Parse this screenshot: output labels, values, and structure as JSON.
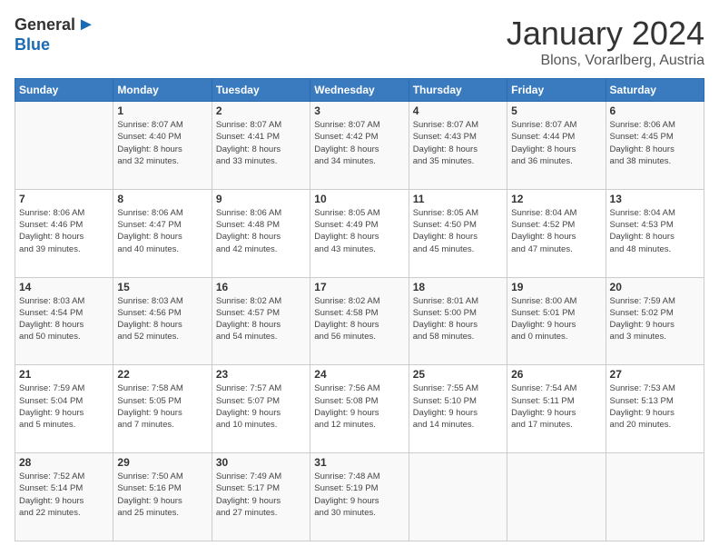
{
  "logo": {
    "general": "General",
    "blue": "Blue"
  },
  "header": {
    "month": "January 2024",
    "location": "Blons, Vorarlberg, Austria"
  },
  "days_of_week": [
    "Sunday",
    "Monday",
    "Tuesday",
    "Wednesday",
    "Thursday",
    "Friday",
    "Saturday"
  ],
  "weeks": [
    [
      {
        "day": "",
        "info": ""
      },
      {
        "day": "1",
        "info": "Sunrise: 8:07 AM\nSunset: 4:40 PM\nDaylight: 8 hours\nand 32 minutes."
      },
      {
        "day": "2",
        "info": "Sunrise: 8:07 AM\nSunset: 4:41 PM\nDaylight: 8 hours\nand 33 minutes."
      },
      {
        "day": "3",
        "info": "Sunrise: 8:07 AM\nSunset: 4:42 PM\nDaylight: 8 hours\nand 34 minutes."
      },
      {
        "day": "4",
        "info": "Sunrise: 8:07 AM\nSunset: 4:43 PM\nDaylight: 8 hours\nand 35 minutes."
      },
      {
        "day": "5",
        "info": "Sunrise: 8:07 AM\nSunset: 4:44 PM\nDaylight: 8 hours\nand 36 minutes."
      },
      {
        "day": "6",
        "info": "Sunrise: 8:06 AM\nSunset: 4:45 PM\nDaylight: 8 hours\nand 38 minutes."
      }
    ],
    [
      {
        "day": "7",
        "info": "Sunrise: 8:06 AM\nSunset: 4:46 PM\nDaylight: 8 hours\nand 39 minutes."
      },
      {
        "day": "8",
        "info": "Sunrise: 8:06 AM\nSunset: 4:47 PM\nDaylight: 8 hours\nand 40 minutes."
      },
      {
        "day": "9",
        "info": "Sunrise: 8:06 AM\nSunset: 4:48 PM\nDaylight: 8 hours\nand 42 minutes."
      },
      {
        "day": "10",
        "info": "Sunrise: 8:05 AM\nSunset: 4:49 PM\nDaylight: 8 hours\nand 43 minutes."
      },
      {
        "day": "11",
        "info": "Sunrise: 8:05 AM\nSunset: 4:50 PM\nDaylight: 8 hours\nand 45 minutes."
      },
      {
        "day": "12",
        "info": "Sunrise: 8:04 AM\nSunset: 4:52 PM\nDaylight: 8 hours\nand 47 minutes."
      },
      {
        "day": "13",
        "info": "Sunrise: 8:04 AM\nSunset: 4:53 PM\nDaylight: 8 hours\nand 48 minutes."
      }
    ],
    [
      {
        "day": "14",
        "info": "Sunrise: 8:03 AM\nSunset: 4:54 PM\nDaylight: 8 hours\nand 50 minutes."
      },
      {
        "day": "15",
        "info": "Sunrise: 8:03 AM\nSunset: 4:56 PM\nDaylight: 8 hours\nand 52 minutes."
      },
      {
        "day": "16",
        "info": "Sunrise: 8:02 AM\nSunset: 4:57 PM\nDaylight: 8 hours\nand 54 minutes."
      },
      {
        "day": "17",
        "info": "Sunrise: 8:02 AM\nSunset: 4:58 PM\nDaylight: 8 hours\nand 56 minutes."
      },
      {
        "day": "18",
        "info": "Sunrise: 8:01 AM\nSunset: 5:00 PM\nDaylight: 8 hours\nand 58 minutes."
      },
      {
        "day": "19",
        "info": "Sunrise: 8:00 AM\nSunset: 5:01 PM\nDaylight: 9 hours\nand 0 minutes."
      },
      {
        "day": "20",
        "info": "Sunrise: 7:59 AM\nSunset: 5:02 PM\nDaylight: 9 hours\nand 3 minutes."
      }
    ],
    [
      {
        "day": "21",
        "info": "Sunrise: 7:59 AM\nSunset: 5:04 PM\nDaylight: 9 hours\nand 5 minutes."
      },
      {
        "day": "22",
        "info": "Sunrise: 7:58 AM\nSunset: 5:05 PM\nDaylight: 9 hours\nand 7 minutes."
      },
      {
        "day": "23",
        "info": "Sunrise: 7:57 AM\nSunset: 5:07 PM\nDaylight: 9 hours\nand 10 minutes."
      },
      {
        "day": "24",
        "info": "Sunrise: 7:56 AM\nSunset: 5:08 PM\nDaylight: 9 hours\nand 12 minutes."
      },
      {
        "day": "25",
        "info": "Sunrise: 7:55 AM\nSunset: 5:10 PM\nDaylight: 9 hours\nand 14 minutes."
      },
      {
        "day": "26",
        "info": "Sunrise: 7:54 AM\nSunset: 5:11 PM\nDaylight: 9 hours\nand 17 minutes."
      },
      {
        "day": "27",
        "info": "Sunrise: 7:53 AM\nSunset: 5:13 PM\nDaylight: 9 hours\nand 20 minutes."
      }
    ],
    [
      {
        "day": "28",
        "info": "Sunrise: 7:52 AM\nSunset: 5:14 PM\nDaylight: 9 hours\nand 22 minutes."
      },
      {
        "day": "29",
        "info": "Sunrise: 7:50 AM\nSunset: 5:16 PM\nDaylight: 9 hours\nand 25 minutes."
      },
      {
        "day": "30",
        "info": "Sunrise: 7:49 AM\nSunset: 5:17 PM\nDaylight: 9 hours\nand 27 minutes."
      },
      {
        "day": "31",
        "info": "Sunrise: 7:48 AM\nSunset: 5:19 PM\nDaylight: 9 hours\nand 30 minutes."
      },
      {
        "day": "",
        "info": ""
      },
      {
        "day": "",
        "info": ""
      },
      {
        "day": "",
        "info": ""
      }
    ]
  ]
}
